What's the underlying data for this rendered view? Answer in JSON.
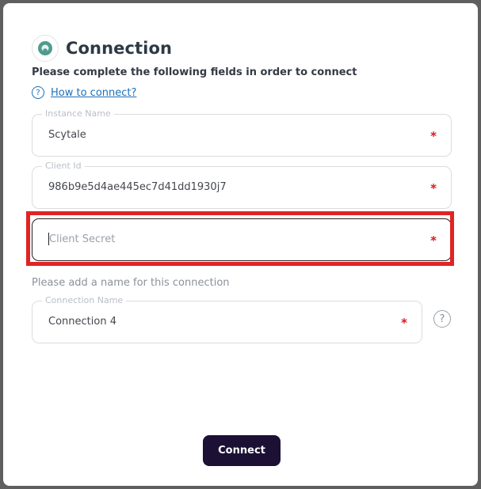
{
  "modal": {
    "title": "Connection",
    "subtitle": "Please complete the following fields in order to connect",
    "how_to_label": "How to connect?",
    "fields": {
      "instance_name": {
        "legend": "Instance Name",
        "value": "Scytale",
        "required": "*"
      },
      "client_id": {
        "legend": "Client Id",
        "value": "986b9e5d4ae445ec7d41dd1930j7",
        "required": "*"
      },
      "client_secret": {
        "placeholder": "Client Secret",
        "required": "*"
      }
    },
    "name_prompt": "Please add a name for this connection",
    "connection_name": {
      "legend": "Connection Name",
      "value": "Connection 4",
      "required": "*"
    },
    "help_icon_symbol": "?",
    "how_to_icon_symbol": "?",
    "connect_label": "Connect"
  },
  "colors": {
    "accent_link": "#1d6fb8",
    "button_bg": "#1d1035",
    "required": "#d71920",
    "highlight": "#e02424"
  },
  "icons": {
    "logo": "connection-logo-icon",
    "help": "question-circle-icon"
  }
}
